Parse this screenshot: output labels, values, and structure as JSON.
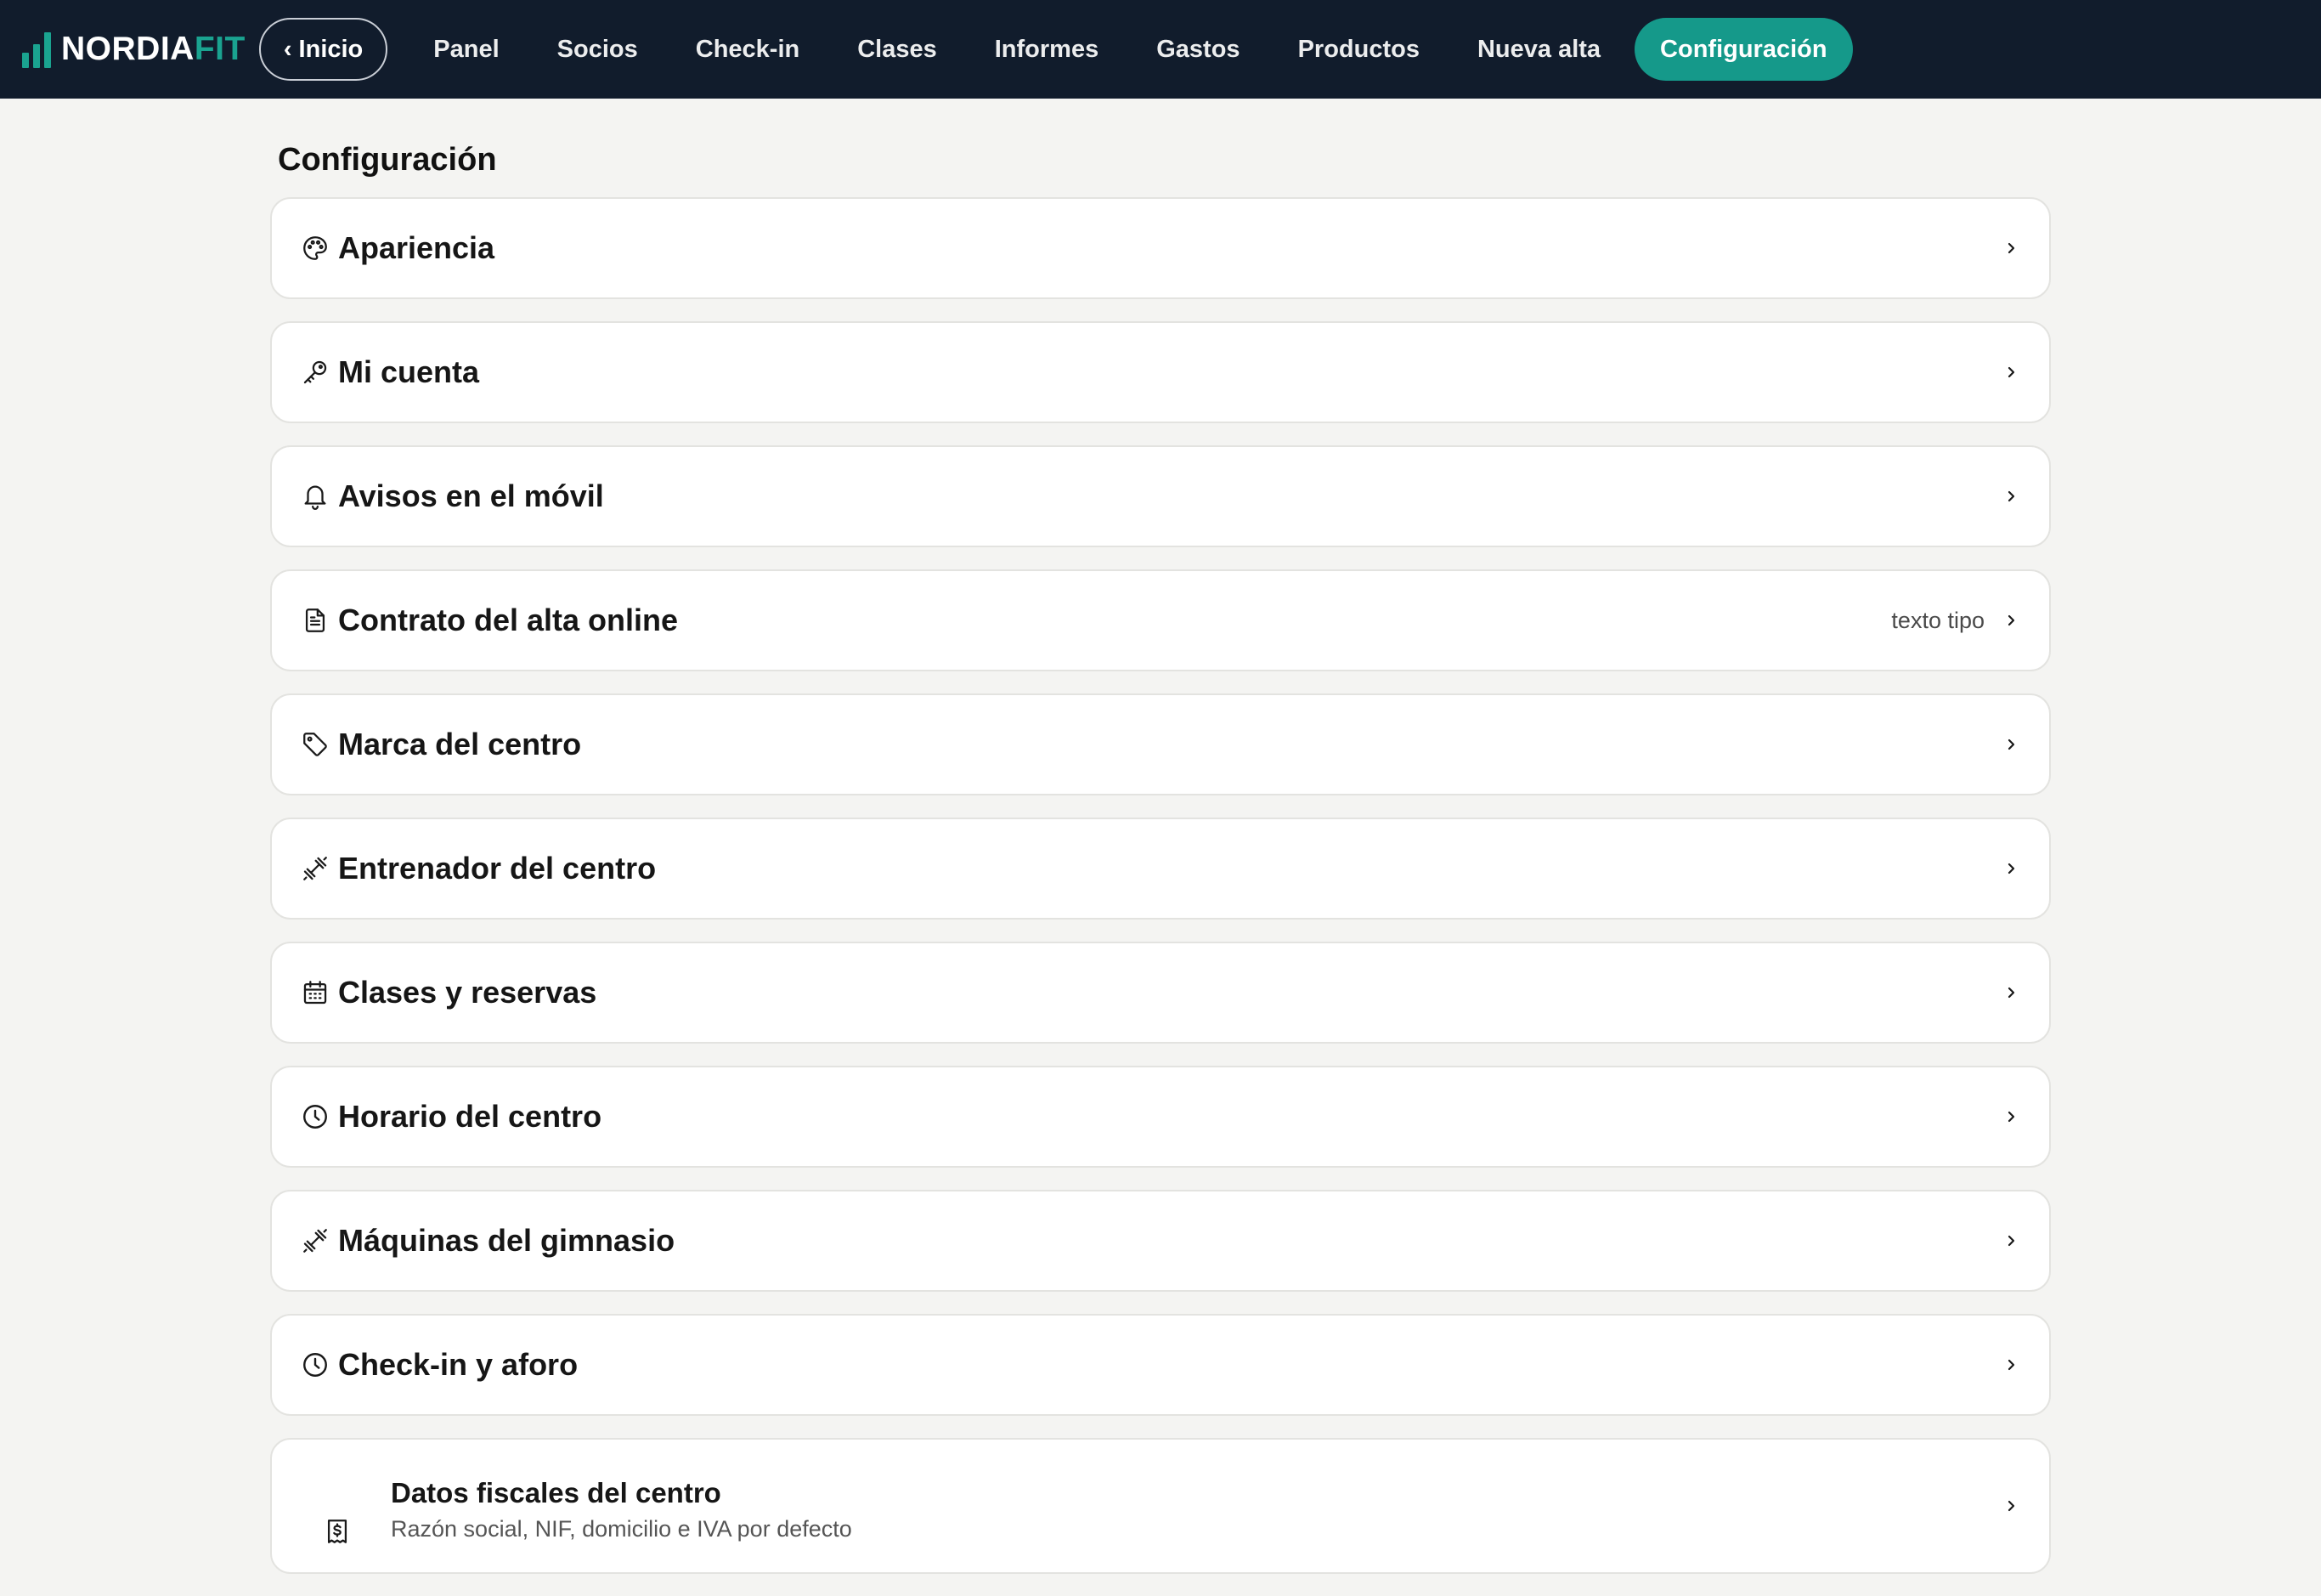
{
  "brand": {
    "name_main": "NORDIA",
    "name_accent": "FIT",
    "accent_color": "#1aa390",
    "nav_bg": "#111c2c",
    "active_bg": "#15998a"
  },
  "back": {
    "label": "‹ Inicio"
  },
  "nav": [
    {
      "label": "Panel"
    },
    {
      "label": "Socios"
    },
    {
      "label": "Check-in"
    },
    {
      "label": "Clases"
    },
    {
      "label": "Informes"
    },
    {
      "label": "Gastos"
    },
    {
      "label": "Productos"
    },
    {
      "label": "Nueva alta"
    },
    {
      "label": "Configuración",
      "active": true
    }
  ],
  "page": {
    "title": "Configuración"
  },
  "settings": [
    {
      "label": "Apariencia",
      "icon": "palette-icon"
    },
    {
      "label": "Mi cuenta",
      "icon": "key-icon"
    },
    {
      "label": "Avisos en el móvil",
      "icon": "bell-icon"
    },
    {
      "label": "Contrato del alta online",
      "icon": "document-icon",
      "hint": "texto tipo"
    },
    {
      "label": "Marca del centro",
      "icon": "tag-icon"
    },
    {
      "label": "Entrenador del centro",
      "icon": "dumbbell-icon"
    },
    {
      "label": "Clases y reservas",
      "icon": "calendar-icon"
    },
    {
      "label": "Horario del centro",
      "icon": "clock-icon"
    },
    {
      "label": "Máquinas del gimnasio",
      "icon": "dumbbell-icon"
    },
    {
      "label": "Check-in y aforo",
      "icon": "clock-icon"
    },
    {
      "label": "Datos fiscales del centro",
      "icon": "receipt-icon",
      "sub": "Razón social, NIF, domicilio e IVA por defecto"
    }
  ]
}
